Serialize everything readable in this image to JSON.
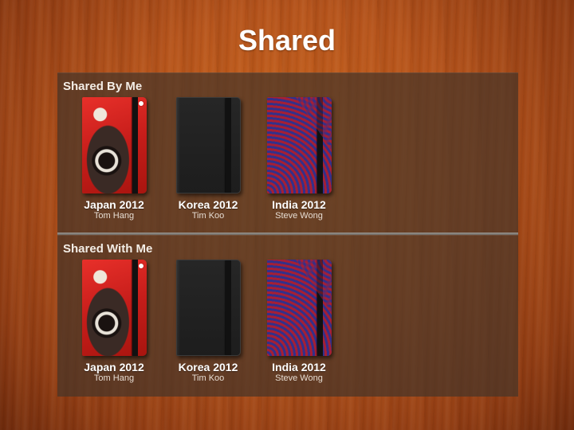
{
  "page": {
    "title": "Shared"
  },
  "shelves": [
    {
      "title": "Shared By Me",
      "books": [
        {
          "title": "Japan 2012",
          "owner": "Tom Hang",
          "cover": "robot-poster-red"
        },
        {
          "title": "Korea 2012",
          "owner": "Tim Koo",
          "cover": "plain-black"
        },
        {
          "title": "India 2012",
          "owner": "Steve Wong",
          "cover": "red-blue-waves"
        }
      ]
    },
    {
      "title": "Shared With Me",
      "books": [
        {
          "title": "Japan 2012",
          "owner": "Tom Hang",
          "cover": "robot-poster-red"
        },
        {
          "title": "Korea 2012",
          "owner": "Tim Koo",
          "cover": "plain-black"
        },
        {
          "title": "India 2012",
          "owner": "Steve Wong",
          "cover": "red-blue-waves"
        }
      ]
    }
  ],
  "colors": {
    "background": "#b4521a",
    "shelf": "#46342880",
    "text": "#ffffff"
  }
}
